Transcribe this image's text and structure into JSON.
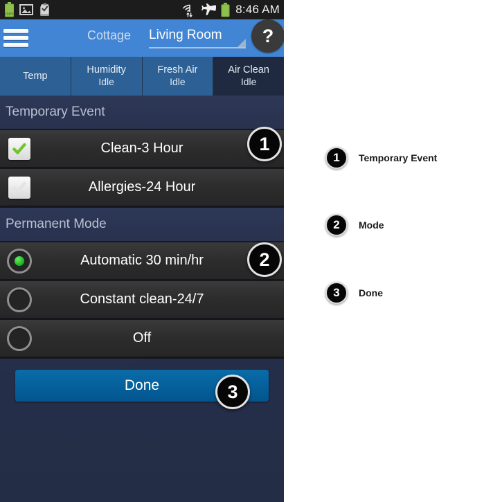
{
  "status_bar": {
    "left_icons": [
      "battery-100-icon",
      "gallery-image-icon",
      "clipboard-check-icon"
    ],
    "right_icons": [
      "wifi-transfer-icon",
      "airplane-mode-icon",
      "battery-icon"
    ],
    "clock": "8:46 AM",
    "battery_label": "100%"
  },
  "action_bar": {
    "menu_icon": "hamburger-menu-icon",
    "app_label": "Cottage",
    "room": "Living Room",
    "caret_icon": "dropdown-caret-icon",
    "help_label": "?"
  },
  "tabs": [
    {
      "label": "Temp",
      "sub": "",
      "active": false
    },
    {
      "label": "Humidity",
      "sub": "Idle",
      "active": false
    },
    {
      "label": "Fresh Air",
      "sub": "Idle",
      "active": false
    },
    {
      "label": "Air Clean",
      "sub": "Idle",
      "active": true
    }
  ],
  "sections": [
    {
      "header": "Temporary Event",
      "type": "checkbox",
      "rows": [
        {
          "label": "Clean-3 Hour",
          "checked": true
        },
        {
          "label": "Allergies-24 Hour",
          "checked": false
        }
      ]
    },
    {
      "header": "Permanent Mode",
      "type": "radio",
      "rows": [
        {
          "label": "Automatic 30 min/hr",
          "selected": true
        },
        {
          "label": "Constant clean-24/7",
          "selected": false
        },
        {
          "label": "Off",
          "selected": false
        }
      ]
    }
  ],
  "done": {
    "label": "Done"
  },
  "callouts": [
    {
      "number": "1",
      "label": "Temporary Event"
    },
    {
      "number": "2",
      "label": "Mode"
    },
    {
      "number": "3",
      "label": "Done"
    }
  ],
  "colors": {
    "action_bar": "#4285d4",
    "tab_inactive": "#2d6196",
    "tab_active": "#1f2a40",
    "page_background": "#26304a",
    "row_background": "#2c2c2c",
    "done_button": "#055f9b",
    "accent_green": "#12b412",
    "status_bar": "#1c1c1c"
  }
}
